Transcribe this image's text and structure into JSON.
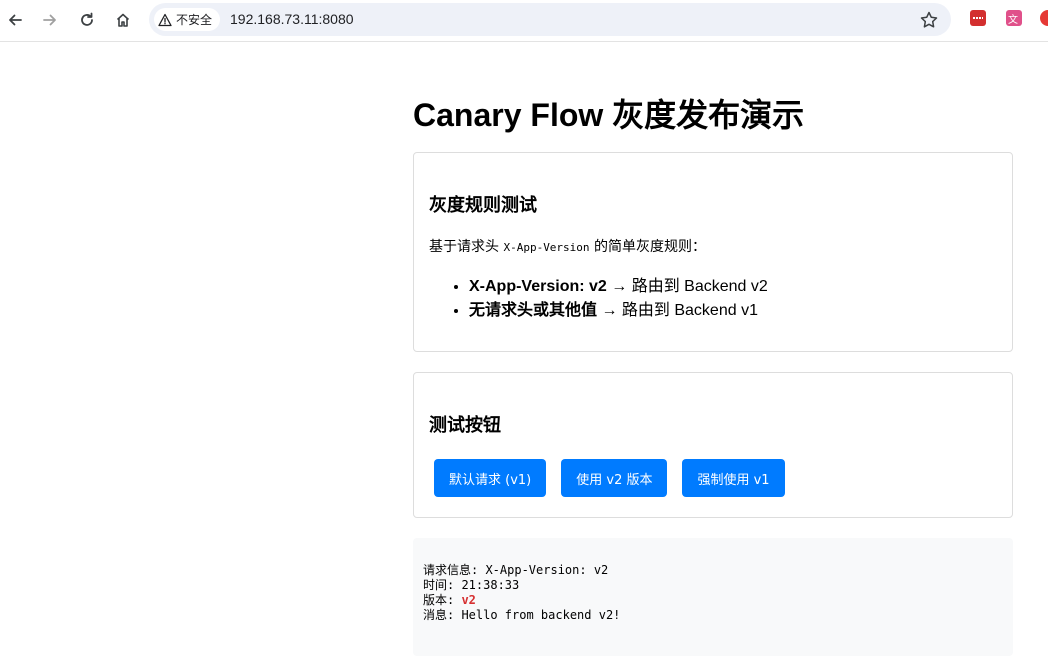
{
  "browser": {
    "security_label": "不安全",
    "url": "192.168.73.11:8080"
  },
  "page": {
    "title": "Canary Flow 灰度发布演示"
  },
  "rules_card": {
    "heading": "灰度规则测试",
    "desc_prefix": "基于请求头 ",
    "desc_code": "X-App-Version",
    "desc_suffix": " 的简单灰度规则：",
    "rules": [
      {
        "bold": "X-App-Version: v2",
        "rest": " → 路由到 Backend v2"
      },
      {
        "bold": "无请求头或其他值",
        "rest": " → 路由到 Backend v1"
      }
    ]
  },
  "buttons_card": {
    "heading": "测试按钮",
    "buttons": [
      {
        "label": "默认请求 (v1)"
      },
      {
        "label": "使用 v2 版本"
      },
      {
        "label": "强制使用 v1"
      }
    ]
  },
  "result": {
    "request_label": "请求信息: ",
    "request_value": "X-App-Version: v2",
    "time_label": "时间: ",
    "time_value": "21:38:33",
    "version_label": "版本: ",
    "version_value": "v2",
    "message_label": "消息: ",
    "message_value": "Hello from backend v2!"
  },
  "colors": {
    "primary": "#007bff",
    "version_highlight": "#d63031"
  }
}
